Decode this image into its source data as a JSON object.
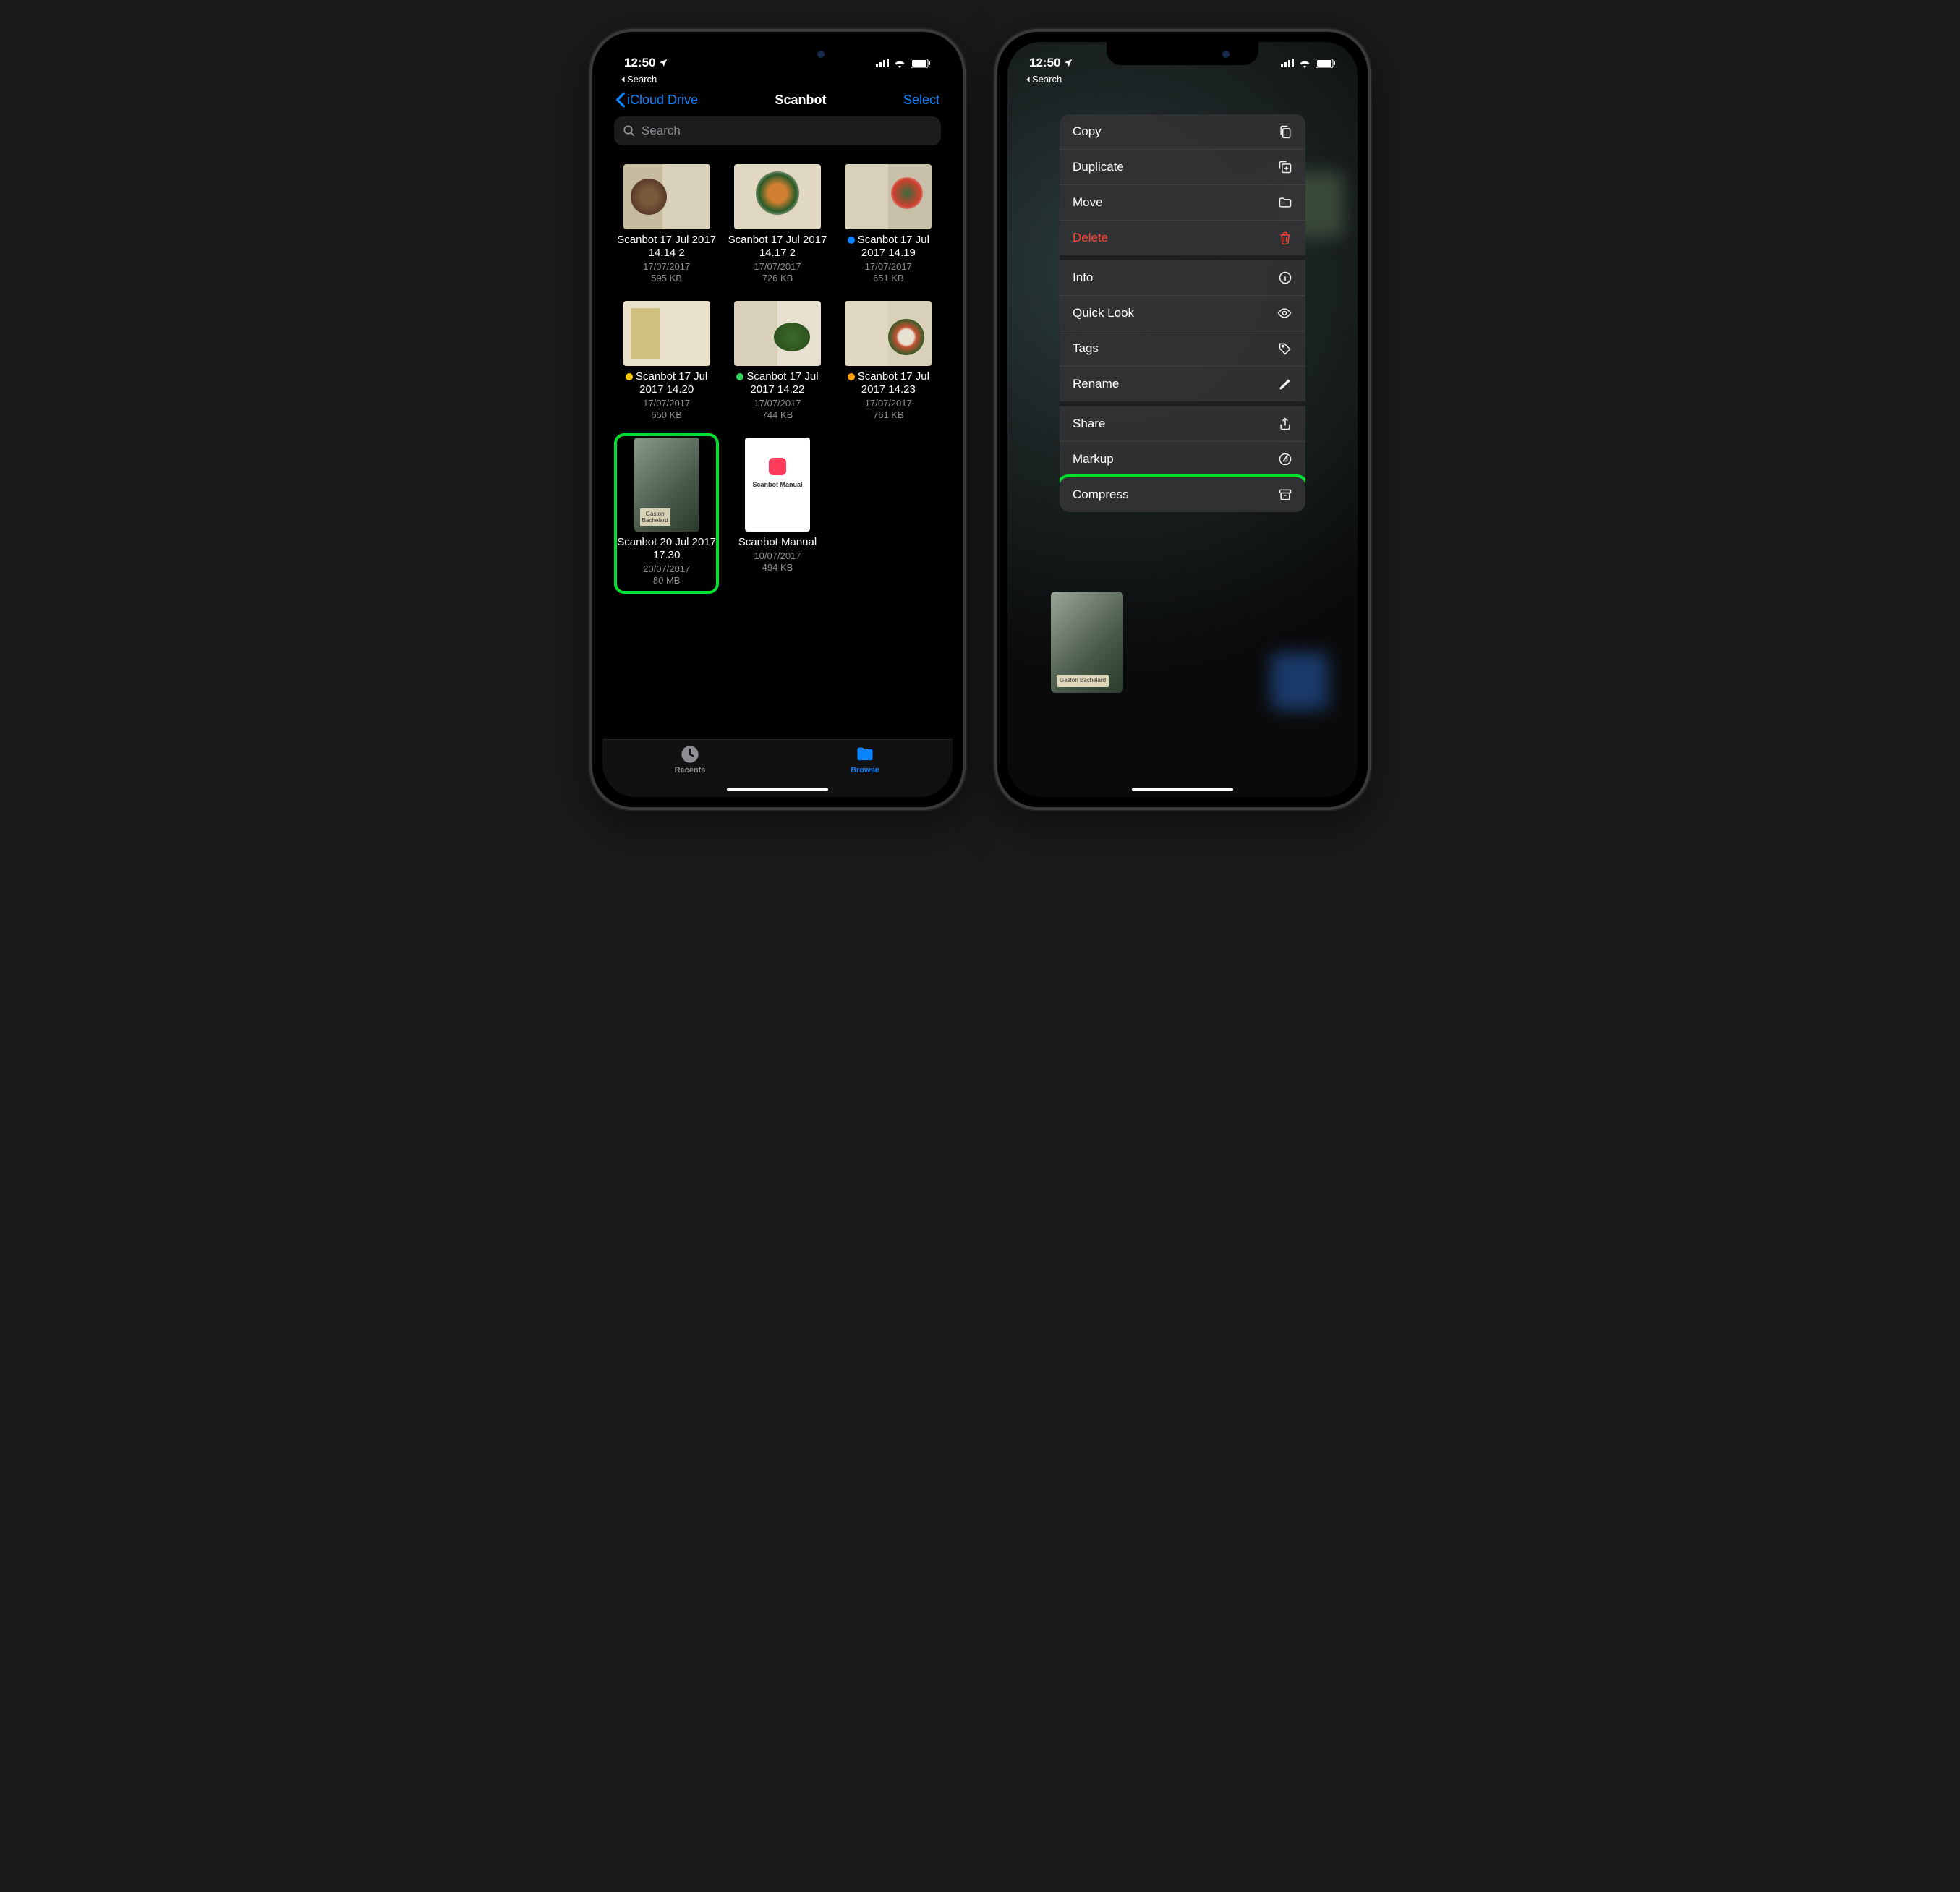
{
  "status": {
    "time": "12:50",
    "back_app": "Search"
  },
  "nav": {
    "back_label": "iCloud Drive",
    "title": "Scanbot",
    "action": "Select"
  },
  "search": {
    "placeholder": "Search"
  },
  "files": [
    {
      "name": "Scanbot 17 Jul 2017 14.14 2",
      "date": "17/07/2017",
      "size": "595 KB",
      "tag": null,
      "thumb": "t-food1"
    },
    {
      "name": "Scanbot 17 Jul 2017 14.17 2",
      "date": "17/07/2017",
      "size": "726 KB",
      "tag": null,
      "thumb": "t-food2"
    },
    {
      "name": "Scanbot 17 Jul 2017 14.19",
      "date": "17/07/2017",
      "size": "651 KB",
      "tag": "#0a84ff",
      "thumb": "t-food3"
    },
    {
      "name": "Scanbot 17 Jul 2017 14.20",
      "date": "17/07/2017",
      "size": "650 KB",
      "tag": "#ffcc00",
      "thumb": "t-book1"
    },
    {
      "name": "Scanbot 17 Jul 2017 14.22",
      "date": "17/07/2017",
      "size": "744 KB",
      "tag": "#30d158",
      "thumb": "t-book2"
    },
    {
      "name": "Scanbot 17 Jul 2017 14.23",
      "date": "17/07/2017",
      "size": "761 KB",
      "tag": "#ff9f0a",
      "thumb": "t-book3"
    },
    {
      "name": "Scanbot 20 Jul 2017 17.30",
      "date": "20/07/2017",
      "size": "80 MB",
      "tag": null,
      "thumb": "t-cover",
      "tall": true,
      "highlight": true
    },
    {
      "name": "Scanbot Manual",
      "date": "10/07/2017",
      "size": "494 KB",
      "tag": null,
      "thumb": "t-manual",
      "tall": true
    }
  ],
  "tabs": {
    "recents": "Recents",
    "browse": "Browse"
  },
  "menu": [
    {
      "label": "Copy",
      "icon": "copy"
    },
    {
      "label": "Duplicate",
      "icon": "duplicate"
    },
    {
      "label": "Move",
      "icon": "folder"
    },
    {
      "label": "Delete",
      "icon": "trash",
      "danger": true,
      "sep": true
    },
    {
      "label": "Info",
      "icon": "info"
    },
    {
      "label": "Quick Look",
      "icon": "eye"
    },
    {
      "label": "Tags",
      "icon": "tag"
    },
    {
      "label": "Rename",
      "icon": "pencil",
      "sep": true
    },
    {
      "label": "Share",
      "icon": "share"
    },
    {
      "label": "Markup",
      "icon": "markup"
    },
    {
      "label": "Compress",
      "icon": "archive",
      "highlight": true
    }
  ],
  "preview_label": "Gaston Bachelard"
}
